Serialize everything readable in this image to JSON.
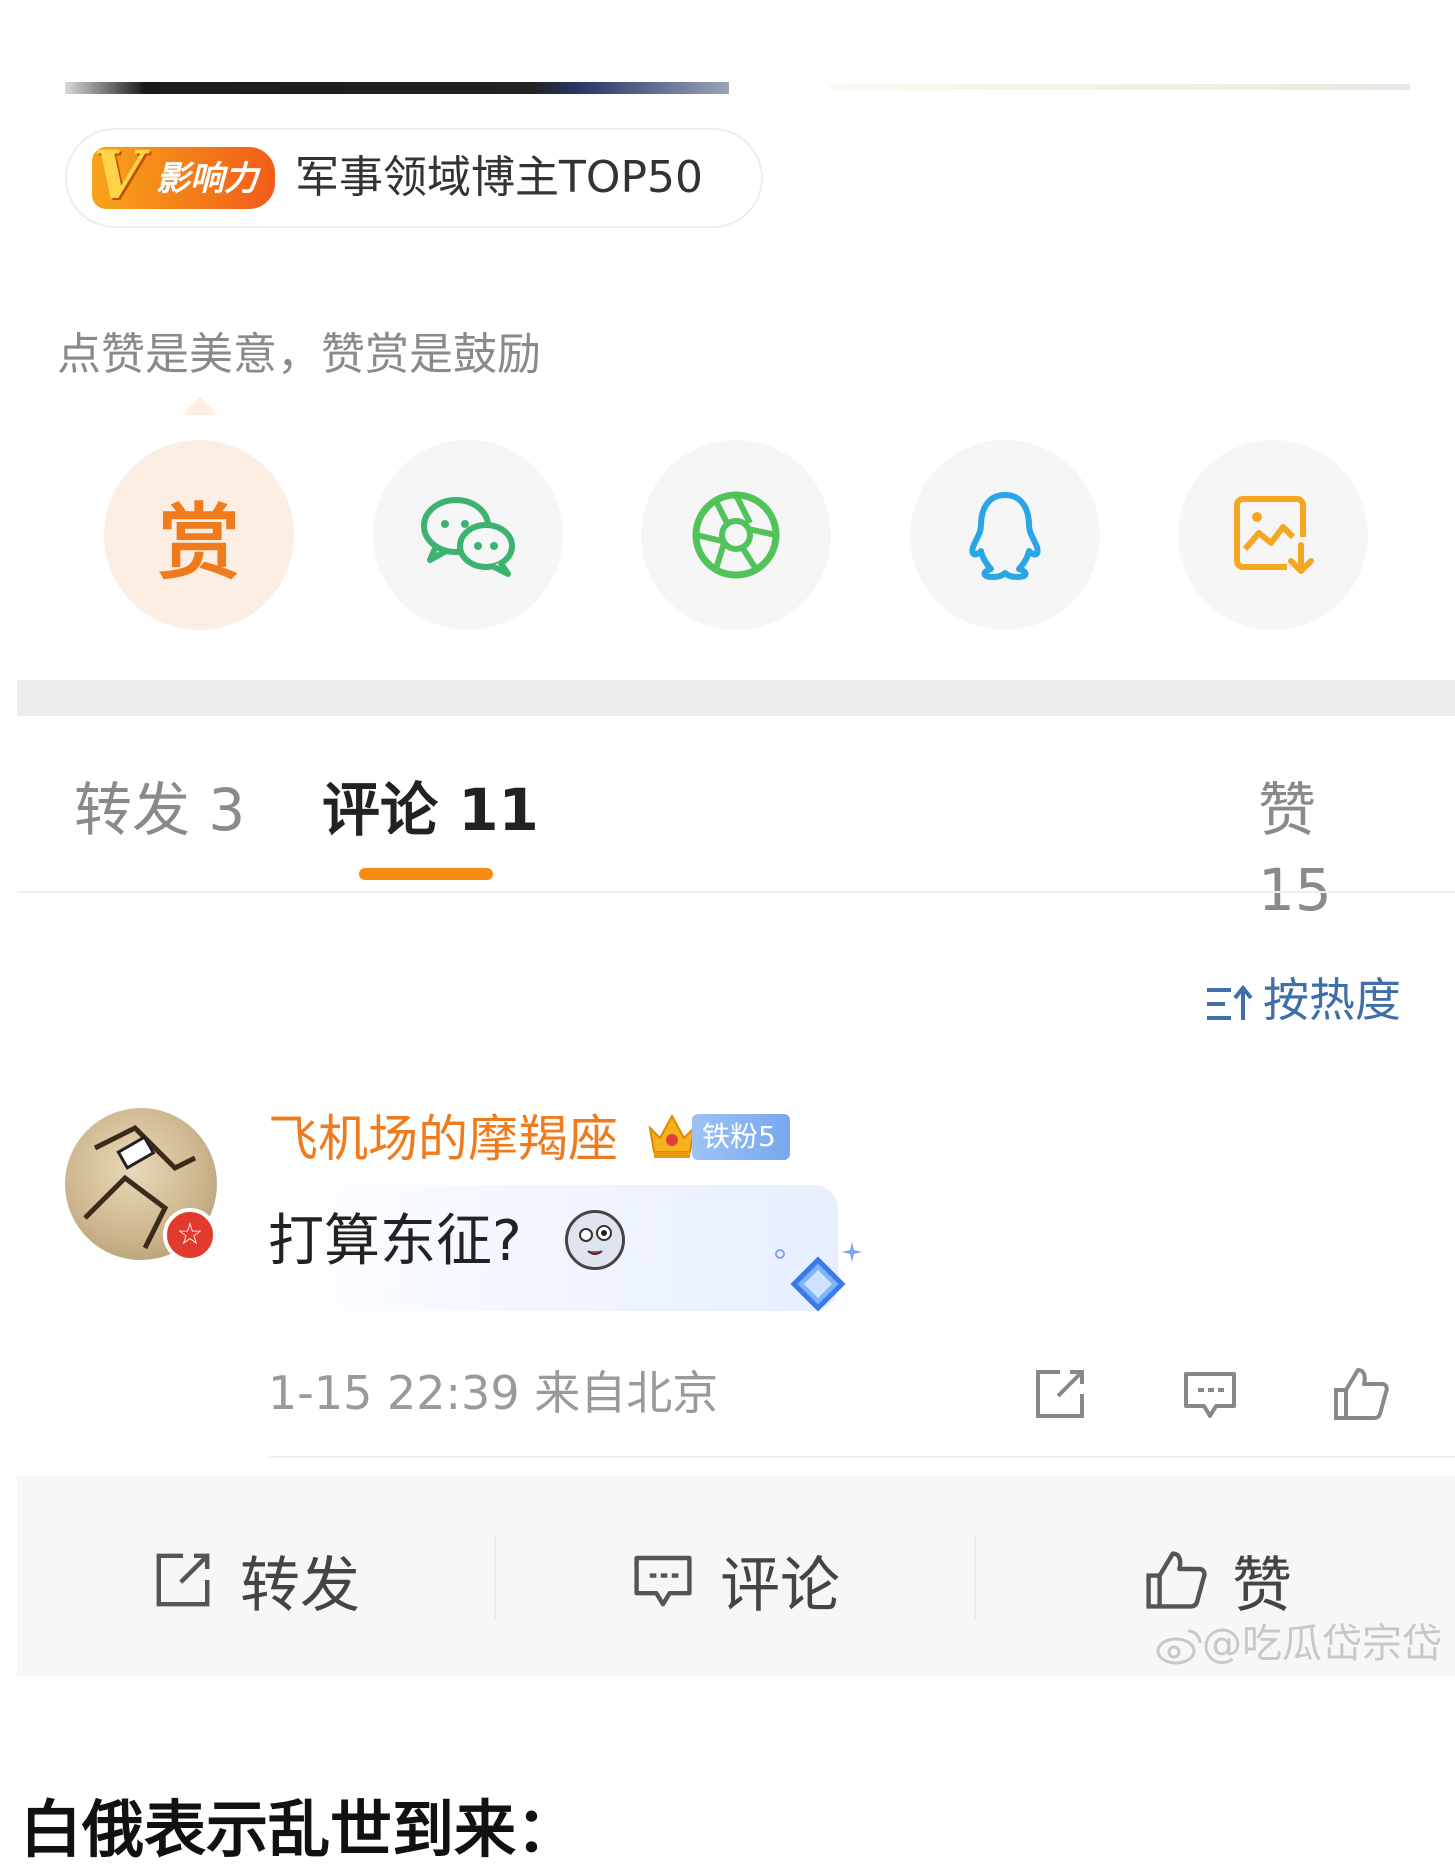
{
  "badge": {
    "tag_label": "影响力",
    "tag_letter": "V",
    "text": "军事领域博主TOP50"
  },
  "reward_hint": "点赞是美意，赞赏是鼓励",
  "share": {
    "reward_label": "赏",
    "items": [
      "reward-icon",
      "wechat-icon",
      "moments-icon",
      "qq-icon",
      "save-image-icon"
    ]
  },
  "tabs": [
    {
      "label": "转发 3",
      "active": false
    },
    {
      "label": "评论 11",
      "active": true
    },
    {
      "label": "赞 15",
      "active": false
    }
  ],
  "sort_label": "按热度",
  "comment": {
    "author": "飞机场的摩羯座",
    "fan_badge": "铁粉5",
    "text": "打算东征?",
    "time_location": "1-15 22:39 来自北京"
  },
  "actions": {
    "repost": "转发",
    "comment": "评论",
    "like": "赞"
  },
  "watermark": "@吃瓜岱宗岱",
  "bottom_title": "白俄表示乱世到来：",
  "colors": {
    "accent_orange": "#f78b12",
    "link_blue": "#3f6ea8",
    "name_orange": "#f07b1c"
  }
}
